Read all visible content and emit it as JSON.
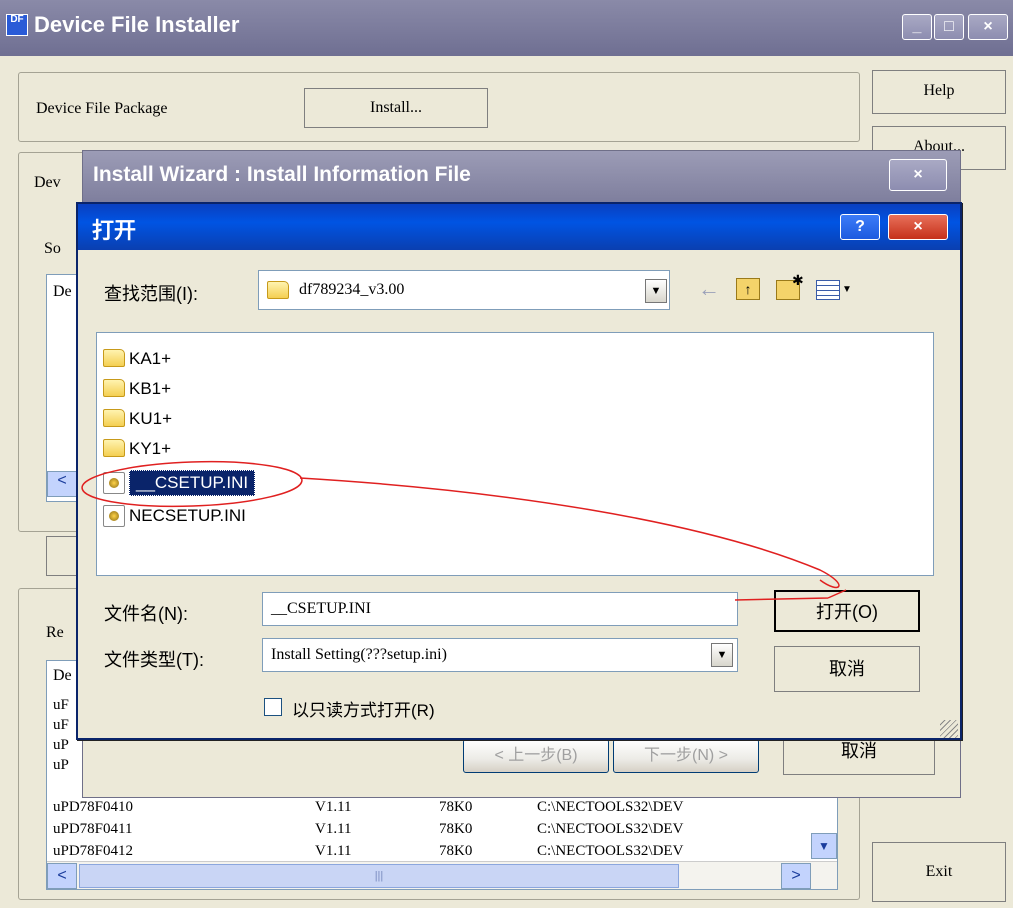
{
  "main": {
    "title": "Device File Installer",
    "app_icon": "DF",
    "package_label": "Device File Package",
    "install_button": "Install...",
    "help_button": "Help",
    "about_button": "About...",
    "exit_button": "Exit",
    "device_group_label": "Dev",
    "software_label": "So",
    "column_d": "De",
    "registered_label": "Re",
    "registered_col": "De",
    "cut_rows": [
      "uF",
      "uF",
      "uP",
      "uP"
    ],
    "table_rows": [
      {
        "device": "uPD78F0410",
        "version": "V1.11",
        "family": "78K0",
        "path": "C:\\NECTOOLS32\\DEV"
      },
      {
        "device": "uPD78F0411",
        "version": "V1.11",
        "family": "78K0",
        "path": "C:\\NECTOOLS32\\DEV"
      },
      {
        "device": "uPD78F0412",
        "version": "V1.11",
        "family": "78K0",
        "path": "C:\\NECTOOLS32\\DEV"
      }
    ]
  },
  "wizard": {
    "title": "Install Wizard : Install Information File",
    "back_button": "< 上一步(B)",
    "next_button": "下一步(N) >",
    "cancel_button": "取消"
  },
  "open_dialog": {
    "title": "打开",
    "help_glyph": "?",
    "look_in_label": "查找范围(I):",
    "look_in_value": "df789234_v3.00",
    "items": [
      {
        "name": "KA1+",
        "type": "folder"
      },
      {
        "name": "KB1+",
        "type": "folder"
      },
      {
        "name": "KU1+",
        "type": "folder"
      },
      {
        "name": "KY1+",
        "type": "folder"
      },
      {
        "name": "__CSETUP.INI",
        "type": "ini",
        "selected": true
      },
      {
        "name": "NECSETUP.INI",
        "type": "ini"
      }
    ],
    "filename_label": "文件名(N):",
    "filename_value": "__CSETUP.INI",
    "filetype_label": "文件类型(T):",
    "filetype_value": "Install Setting(???setup.ini)",
    "readonly_label": "以只读方式打开(R)",
    "open_button": "打开(O)",
    "cancel_button": "取消"
  },
  "colors": {
    "annotation": "#e02020",
    "selection": "#0a246a"
  }
}
